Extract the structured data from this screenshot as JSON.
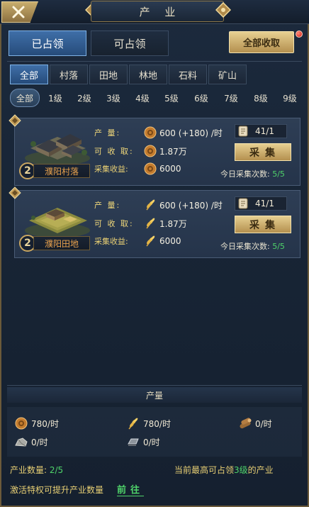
{
  "header": {
    "title": "产 业"
  },
  "main_tabs": {
    "occupied": "已占领",
    "occupiable": "可占领",
    "collect_all": "全部收取"
  },
  "categories": [
    "全部",
    "村落",
    "田地",
    "林地",
    "石料",
    "矿山"
  ],
  "levels": [
    "全部",
    "1级",
    "2级",
    "3级",
    "4级",
    "5级",
    "6级",
    "7级",
    "8级",
    "9级"
  ],
  "labels": {
    "output": "产    量:",
    "collectible": "可 收 取:",
    "gather_income": "采集收益:",
    "gather_button": "采集",
    "today_label": "今日采集次数:"
  },
  "cards": [
    {
      "level": "2",
      "name": "濮阳村落",
      "resource_icon": "coin-icon",
      "output": "600 (+180) /时",
      "collectible": "1.87万",
      "gather_income": "6000",
      "scroll_count": "41/1",
      "today_count": "5/5"
    },
    {
      "level": "2",
      "name": "濮阳田地",
      "resource_icon": "wheat-icon",
      "output": "600 (+180) /时",
      "collectible": "1.87万",
      "gather_income": "6000",
      "scroll_count": "41/1",
      "today_count": "5/5"
    }
  ],
  "footer": {
    "title": "产量",
    "coin": "780/时",
    "grain": "780/时",
    "wood": "0/时",
    "stone": "0/时",
    "iron": "0/时"
  },
  "bottom": {
    "count_label": "产业数量:",
    "count_value": "2/5",
    "max_level_prefix": "当前最高可占领",
    "max_level_value": "3级",
    "max_level_suffix": "的产业",
    "privilege_text": "激活特权可提升产业数量",
    "goto": "前往"
  },
  "colors": {
    "accent_gold": "#c9a660",
    "active_blue": "#3f6fa8",
    "green": "#4fd36a",
    "name_orange": "#e9a24d"
  }
}
